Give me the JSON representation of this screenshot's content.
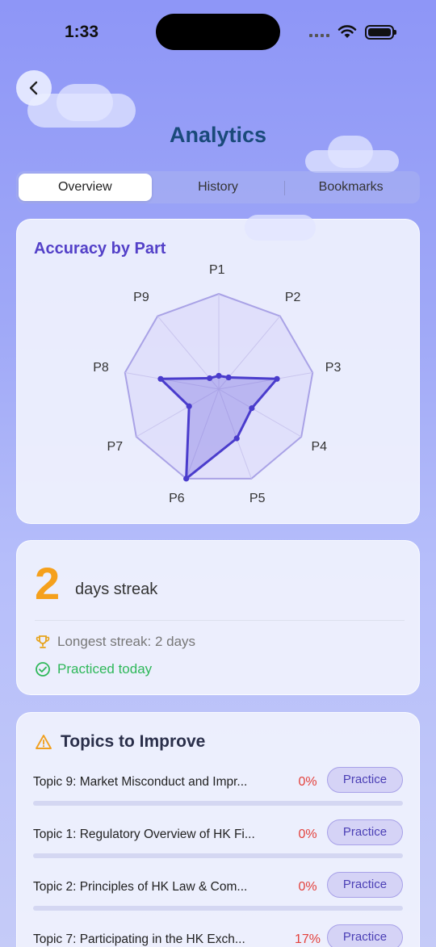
{
  "status": {
    "time": "1:33"
  },
  "header": {
    "title": "Analytics"
  },
  "tabs": [
    {
      "label": "Overview",
      "active": true
    },
    {
      "label": "History",
      "active": false
    },
    {
      "label": "Bookmarks",
      "active": false
    }
  ],
  "radar": {
    "title": "Accuracy by Part",
    "chart_data": {
      "type": "radar",
      "categories": [
        "P1",
        "P2",
        "P3",
        "P4",
        "P5",
        "P6",
        "P7",
        "P8",
        "P9"
      ],
      "values": [
        0.14,
        0.16,
        0.62,
        0.4,
        0.55,
        1.0,
        0.36,
        0.62,
        0.15
      ],
      "range": [
        0,
        1
      ],
      "colors": {
        "fill": "#5a4ad6",
        "stroke": "#4a3ccc",
        "grid": "#a9a2e6"
      }
    }
  },
  "streak": {
    "number": "2",
    "text": "days streak",
    "longest": "Longest streak: 2 days",
    "today": "Practiced today"
  },
  "topics": {
    "title": "Topics to Improve",
    "items": [
      {
        "name": "Topic 9: Market Misconduct and Impr...",
        "pct": "0%",
        "button": "Practice",
        "progress": 0.0
      },
      {
        "name": "Topic 1: Regulatory Overview of HK Fi...",
        "pct": "0%",
        "button": "Practice",
        "progress": 0.0
      },
      {
        "name": "Topic 2: Principles of HK Law & Com...",
        "pct": "0%",
        "button": "Practice",
        "progress": 0.0
      },
      {
        "name": "Topic 7: Participating in the HK Exch...",
        "pct": "17%",
        "button": "Practice",
        "progress": 0.17
      }
    ]
  }
}
